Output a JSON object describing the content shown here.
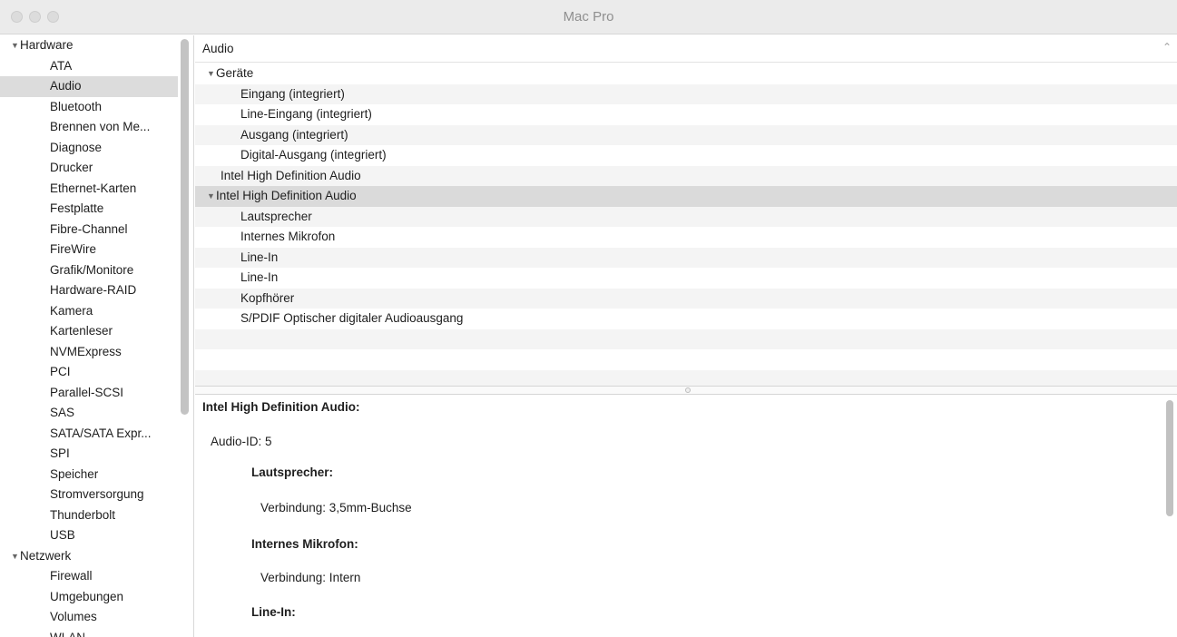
{
  "window": {
    "title": "Mac Pro"
  },
  "sidebar": {
    "groups": [
      {
        "label": "Hardware",
        "expanded": true,
        "items": [
          "ATA",
          "Audio",
          "Bluetooth",
          "Brennen von Me...",
          "Diagnose",
          "Drucker",
          "Ethernet-Karten",
          "Festplatte",
          "Fibre-Channel",
          "FireWire",
          "Grafik/Monitore",
          "Hardware-RAID",
          "Kamera",
          "Kartenleser",
          "NVMExpress",
          "PCI",
          "Parallel-SCSI",
          "SAS",
          "SATA/SATA Expr...",
          "SPI",
          "Speicher",
          "Stromversorgung",
          "Thunderbolt",
          "USB"
        ]
      },
      {
        "label": "Netzwerk",
        "expanded": true,
        "items": [
          "Firewall",
          "Umgebungen",
          "Volumes",
          "WLAN"
        ]
      }
    ],
    "selected": "Audio"
  },
  "tree": {
    "header": "Audio",
    "rows": [
      {
        "label": "Geräte",
        "level": 0,
        "expandable": true
      },
      {
        "label": "Eingang (integriert)",
        "level": 2
      },
      {
        "label": "Line-Eingang (integriert)",
        "level": 2
      },
      {
        "label": "Ausgang (integriert)",
        "level": 2
      },
      {
        "label": "Digital-Ausgang (integriert)",
        "level": 2
      },
      {
        "label": "Intel High Definition Audio",
        "level": 1
      },
      {
        "label": "Intel High Definition Audio",
        "level": 0,
        "expandable": true,
        "selected": true
      },
      {
        "label": "Lautsprecher",
        "level": 2
      },
      {
        "label": "Internes Mikrofon",
        "level": 2
      },
      {
        "label": "Line-In",
        "level": 2
      },
      {
        "label": "Line-In",
        "level": 2
      },
      {
        "label": "Kopfhörer",
        "level": 2
      },
      {
        "label": "S/PDIF Optischer digitaler Audioausgang",
        "level": 2
      }
    ]
  },
  "detail": {
    "title": "Intel High Definition Audio:",
    "audio_id": "Audio-ID:  5",
    "sections": [
      {
        "heading": "Lautsprecher:",
        "line": "Verbindung:  3,5mm-Buchse"
      },
      {
        "heading": "Internes Mikrofon:",
        "line": "Verbindung:  Intern"
      },
      {
        "heading": "Line-In:"
      }
    ]
  }
}
